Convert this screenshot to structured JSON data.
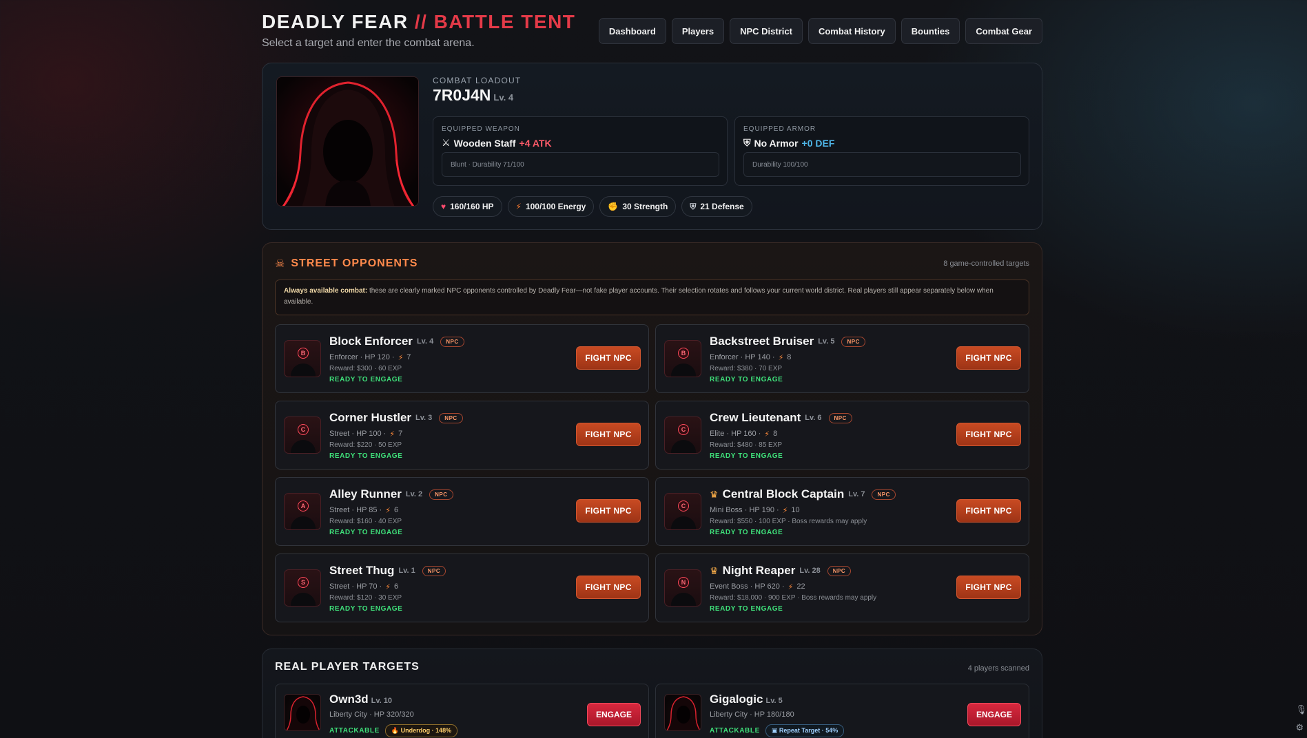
{
  "header": {
    "title_main": "DEADLY FEAR",
    "title_sep": " // ",
    "title_accent": "BATTLE TENT",
    "subtitle": "Select a target and enter the combat arena."
  },
  "nav": [
    "Dashboard",
    "Players",
    "NPC District",
    "Combat History",
    "Bounties",
    "Combat Gear"
  ],
  "loadout": {
    "label": "COMBAT LOADOUT",
    "player_name": "7R0J4N",
    "player_level": "Lv. 4",
    "weapon": {
      "label": "EQUIPPED WEAPON",
      "icon": "crossed-swords-icon",
      "name": "Wooden Staff",
      "bonus": "+4 ATK",
      "detail": "Blunt · Durability 71/100"
    },
    "armor": {
      "label": "EQUIPPED ARMOR",
      "icon": "shield-icon",
      "name": "No Armor",
      "bonus": "+0 DEF",
      "detail": "Durability 100/100"
    },
    "stats": [
      {
        "icon": "heart-icon",
        "glyph": "♥",
        "color": "#ff4b6e",
        "text": "160/160 HP"
      },
      {
        "icon": "bolt-icon",
        "glyph": "⚡",
        "color": "#ff7b2e",
        "text": "100/100 Energy"
      },
      {
        "icon": "flexed-arm-icon",
        "glyph": "✊",
        "color": "#ffc64a",
        "text": "30 Strength"
      },
      {
        "icon": "shield-icon",
        "glyph": "⛨",
        "color": "#c9ced6",
        "text": "21 Defense"
      }
    ]
  },
  "opponents": {
    "title": "STREET OPPONENTS",
    "count": "8 game-controlled targets",
    "notice_bold": "Always available combat:",
    "notice_text": " these are clearly marked NPC opponents controlled by Deadly Fear—not fake player accounts. Their selection rotates and follows your current world district. Real players still appear separately below when available.",
    "badge": "NPC",
    "status": "READY TO ENGAGE",
    "button": "FIGHT NPC",
    "items": [
      {
        "letter": "B",
        "name": "Block Enforcer",
        "level": "Lv. 4",
        "boss": false,
        "meta": "Enforcer · HP 120 ·",
        "energy": "7",
        "reward": "Reward: $300 · 60 EXP"
      },
      {
        "letter": "B",
        "name": "Backstreet Bruiser",
        "level": "Lv. 5",
        "boss": false,
        "meta": "Enforcer · HP 140 ·",
        "energy": "8",
        "reward": "Reward: $380 · 70 EXP"
      },
      {
        "letter": "C",
        "name": "Corner Hustler",
        "level": "Lv. 3",
        "boss": false,
        "meta": "Street · HP 100 ·",
        "energy": "7",
        "reward": "Reward: $220 · 50 EXP"
      },
      {
        "letter": "C",
        "name": "Crew Lieutenant",
        "level": "Lv. 6",
        "boss": false,
        "meta": "Elite · HP 160 ·",
        "energy": "8",
        "reward": "Reward: $480 · 85 EXP"
      },
      {
        "letter": "A",
        "name": "Alley Runner",
        "level": "Lv. 2",
        "boss": false,
        "meta": "Street · HP 85 ·",
        "energy": "6",
        "reward": "Reward: $160 · 40 EXP"
      },
      {
        "letter": "C",
        "name": "Central Block Captain",
        "level": "Lv. 7",
        "boss": true,
        "meta": "Mini Boss · HP 190 ·",
        "energy": "10",
        "reward": "Reward: $550 · 100 EXP · Boss rewards may apply"
      },
      {
        "letter": "S",
        "name": "Street Thug",
        "level": "Lv. 1",
        "boss": false,
        "meta": "Street · HP 70 ·",
        "energy": "6",
        "reward": "Reward: $120 · 30 EXP"
      },
      {
        "letter": "N",
        "name": "Night Reaper",
        "level": "Lv. 28",
        "boss": true,
        "meta": "Event Boss · HP 620 ·",
        "energy": "22",
        "reward": "Reward: $18,000 · 900 EXP · Boss rewards may apply"
      }
    ]
  },
  "players": {
    "title": "REAL PLAYER TARGETS",
    "count": "4 players scanned",
    "status": "ATTACKABLE",
    "button": "ENGAGE",
    "items": [
      {
        "name": "Own3d",
        "level": "Lv. 10",
        "meta": "Liberty City · HP 320/320",
        "tag": "Underdog · 148%",
        "tag_icon": "flame-icon",
        "tag_glyph": "🔥",
        "tag_type": "under"
      },
      {
        "name": "Gigalogic",
        "level": "Lv. 5",
        "meta": "Liberty City · HP 180/180",
        "tag": "Repeat Target · 54%",
        "tag_icon": "repeat-icon",
        "tag_glyph": "▣",
        "tag_type": "repeat"
      }
    ]
  }
}
